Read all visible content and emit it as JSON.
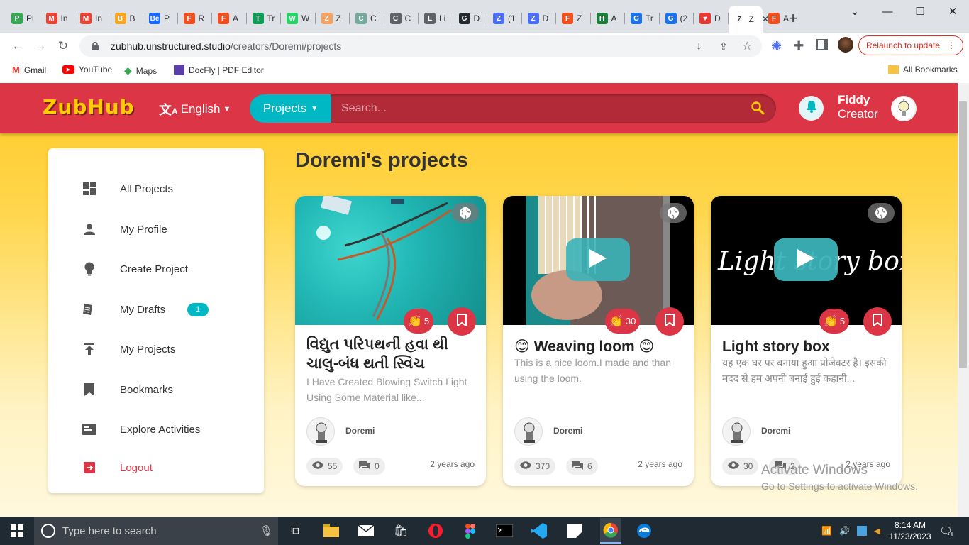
{
  "browser": {
    "tabs": [
      {
        "label": "Pi",
        "color": "#34a853",
        "glyph": "P"
      },
      {
        "label": "In",
        "color": "#ea4335",
        "glyph": "M"
      },
      {
        "label": "In",
        "color": "#ea4335",
        "glyph": "M"
      },
      {
        "label": "B",
        "color": "#f5a623",
        "glyph": "B"
      },
      {
        "label": "P",
        "color": "#1769ff",
        "glyph": "Bē"
      },
      {
        "label": "R",
        "color": "#f24e1e",
        "glyph": "F"
      },
      {
        "label": "A",
        "color": "#f24e1e",
        "glyph": "F"
      },
      {
        "label": "Tr",
        "color": "#0f9d58",
        "glyph": "T"
      },
      {
        "label": "W",
        "color": "#25d366",
        "glyph": "W"
      },
      {
        "label": "Z",
        "color": "#f4a261",
        "glyph": "Z"
      },
      {
        "label": "C",
        "color": "#74aa9c",
        "glyph": "C"
      },
      {
        "label": "C",
        "color": "#5f6368",
        "glyph": "C"
      },
      {
        "label": "Li",
        "color": "#5f6368",
        "glyph": "L"
      },
      {
        "label": "D",
        "color": "#24292e",
        "glyph": "G"
      },
      {
        "label": "(1",
        "color": "#4c6ef5",
        "glyph": "Z"
      },
      {
        "label": "D",
        "color": "#4c6ef5",
        "glyph": "Z"
      },
      {
        "label": "Z",
        "color": "#f24e1e",
        "glyph": "F"
      },
      {
        "label": "A",
        "color": "#1b7f3b",
        "glyph": "H"
      },
      {
        "label": "Tr",
        "color": "#1a73e8",
        "glyph": "G"
      },
      {
        "label": "(2",
        "color": "#1a73e8",
        "glyph": "G"
      },
      {
        "label": "D",
        "color": "#e53935",
        "glyph": "♥"
      },
      {
        "label": "Z",
        "color": "#ffffff",
        "glyph": "Z",
        "active": true
      },
      {
        "label": "A",
        "color": "#f24e1e",
        "glyph": "F"
      }
    ],
    "url_host": "zubhub.unstructured.studio",
    "url_path": "/creators/Doremi/projects",
    "relaunch_label": "Relaunch to update",
    "bookmarks": [
      "Gmail",
      "YouTube",
      "Maps",
      "DocFly | PDF Editor"
    ],
    "all_bookmarks": "All Bookmarks"
  },
  "header": {
    "logo": "ZubHub",
    "language": "English",
    "search_category": "Projects",
    "search_placeholder": "Search...",
    "user_name": "Fiddy",
    "user_role": "Creator"
  },
  "sidebar": {
    "items": [
      {
        "label": "All Projects"
      },
      {
        "label": "My Profile"
      },
      {
        "label": "Create Project"
      },
      {
        "label": "My Drafts",
        "badge": "1"
      },
      {
        "label": "My Projects"
      },
      {
        "label": "Bookmarks"
      },
      {
        "label": "Explore Activities"
      },
      {
        "label": "Logout"
      }
    ]
  },
  "main": {
    "title": "Doremi's projects",
    "cards": [
      {
        "title": "વિદ્યુત પરિપથની હવા થી ચાલુ-બંધ થતી સ્વિચ",
        "description": "I Have Created Blowing Switch Light Using Some Material like...",
        "claps": "5",
        "author": "Doremi",
        "views": "55",
        "comments": "0",
        "ago": "2 years ago"
      },
      {
        "title": "😊 Weaving loom 😊",
        "description": "This is a nice loom.I made and than using the loom.",
        "claps": "30",
        "author": "Doremi",
        "views": "370",
        "comments": "6",
        "ago": "2 years ago"
      },
      {
        "title": "Light story box",
        "description": "यह एक घर पर बनाया हुआ प्रोजेक्टर है। इसकी मदद से हम अपनी बनाई हुई कहानी...",
        "claps": "5",
        "author": "Doremi",
        "views": "30",
        "comments": "2",
        "ago": "2 years ago",
        "thumb_text": "Light story box"
      }
    ]
  },
  "watermark": {
    "line1": "Activate Windows",
    "line2": "Go to Settings to activate Windows."
  },
  "taskbar": {
    "search_placeholder": "Type here to search",
    "time": "8:14 AM",
    "date": "11/23/2023",
    "notifications": "1"
  }
}
